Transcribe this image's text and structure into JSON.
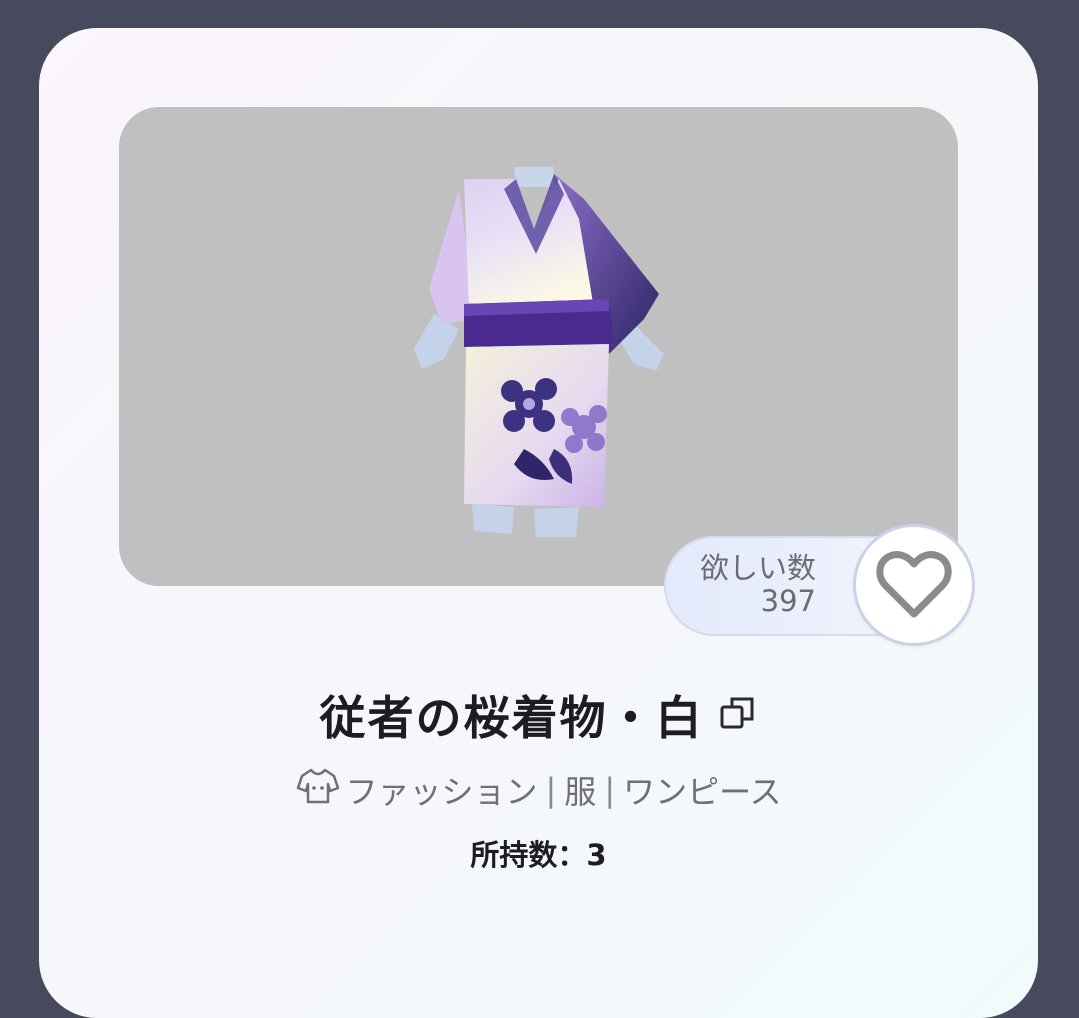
{
  "item": {
    "name": "従者の桜着物・白",
    "image_description_icon": "kimono-item-icon"
  },
  "wish": {
    "label": "欲しい数",
    "count": "397",
    "icon": "heart-outline-icon"
  },
  "category": {
    "icon": "shirt-icon",
    "parts": [
      "ファッション",
      "服",
      "ワンピース"
    ],
    "separator": "|"
  },
  "owned": {
    "text": "所持数：3"
  },
  "colors": {
    "background": "#474a5c",
    "image_bg": "#c0c0c0",
    "kimono_dark": "#3b2f7a",
    "kimono_light": "#e9dff5"
  }
}
